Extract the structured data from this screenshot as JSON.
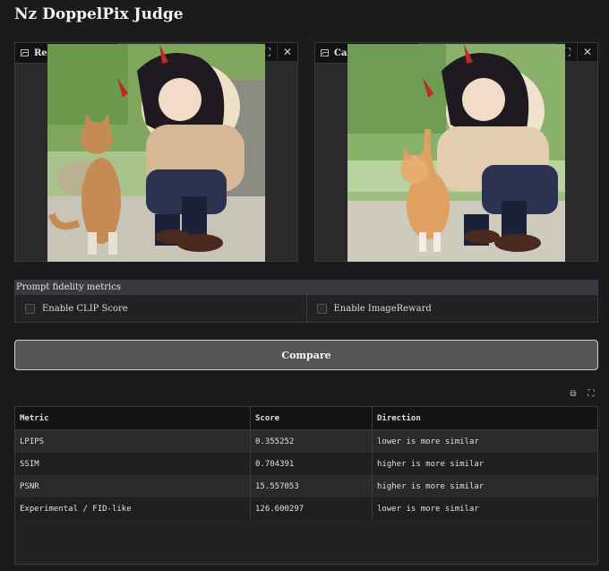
{
  "app": {
    "title": "Nz DoppelPix Judge"
  },
  "reference_panel": {
    "label": "Reference PNG",
    "image_icon": "image-icon",
    "fullscreen_icon": "fullscreen-icon",
    "close_icon": "close-icon"
  },
  "candidate_panel": {
    "label": "Candidate PNG",
    "image_icon": "image-icon",
    "fullscreen_icon": "fullscreen-icon",
    "close_icon": "close-icon"
  },
  "prompt_fidelity": {
    "title": "Prompt fidelity metrics",
    "options": [
      {
        "label": "Enable CLIP Score",
        "checked": false
      },
      {
        "label": "Enable ImageReward",
        "checked": false
      }
    ]
  },
  "compare_button": {
    "label": "Compare"
  },
  "results_toolbar": {
    "copy_icon": "copy-icon",
    "fullscreen_icon": "fullscreen-icon"
  },
  "results": {
    "headers": [
      "Metric",
      "Score",
      "Direction"
    ],
    "rows": [
      [
        "LPIPS",
        "0.355252",
        "lower is more similar"
      ],
      [
        "SSIM",
        "0.704391",
        "higher is more similar"
      ],
      [
        "PSNR",
        "15.557053",
        "higher is more similar"
      ],
      [
        "Experimental / FID-like",
        "126.600297",
        "lower is more similar"
      ]
    ]
  },
  "colors": {
    "background": "#1b1b1d",
    "panel": "#2a2a2d",
    "border": "#3a3a3e",
    "button": "#565658"
  }
}
